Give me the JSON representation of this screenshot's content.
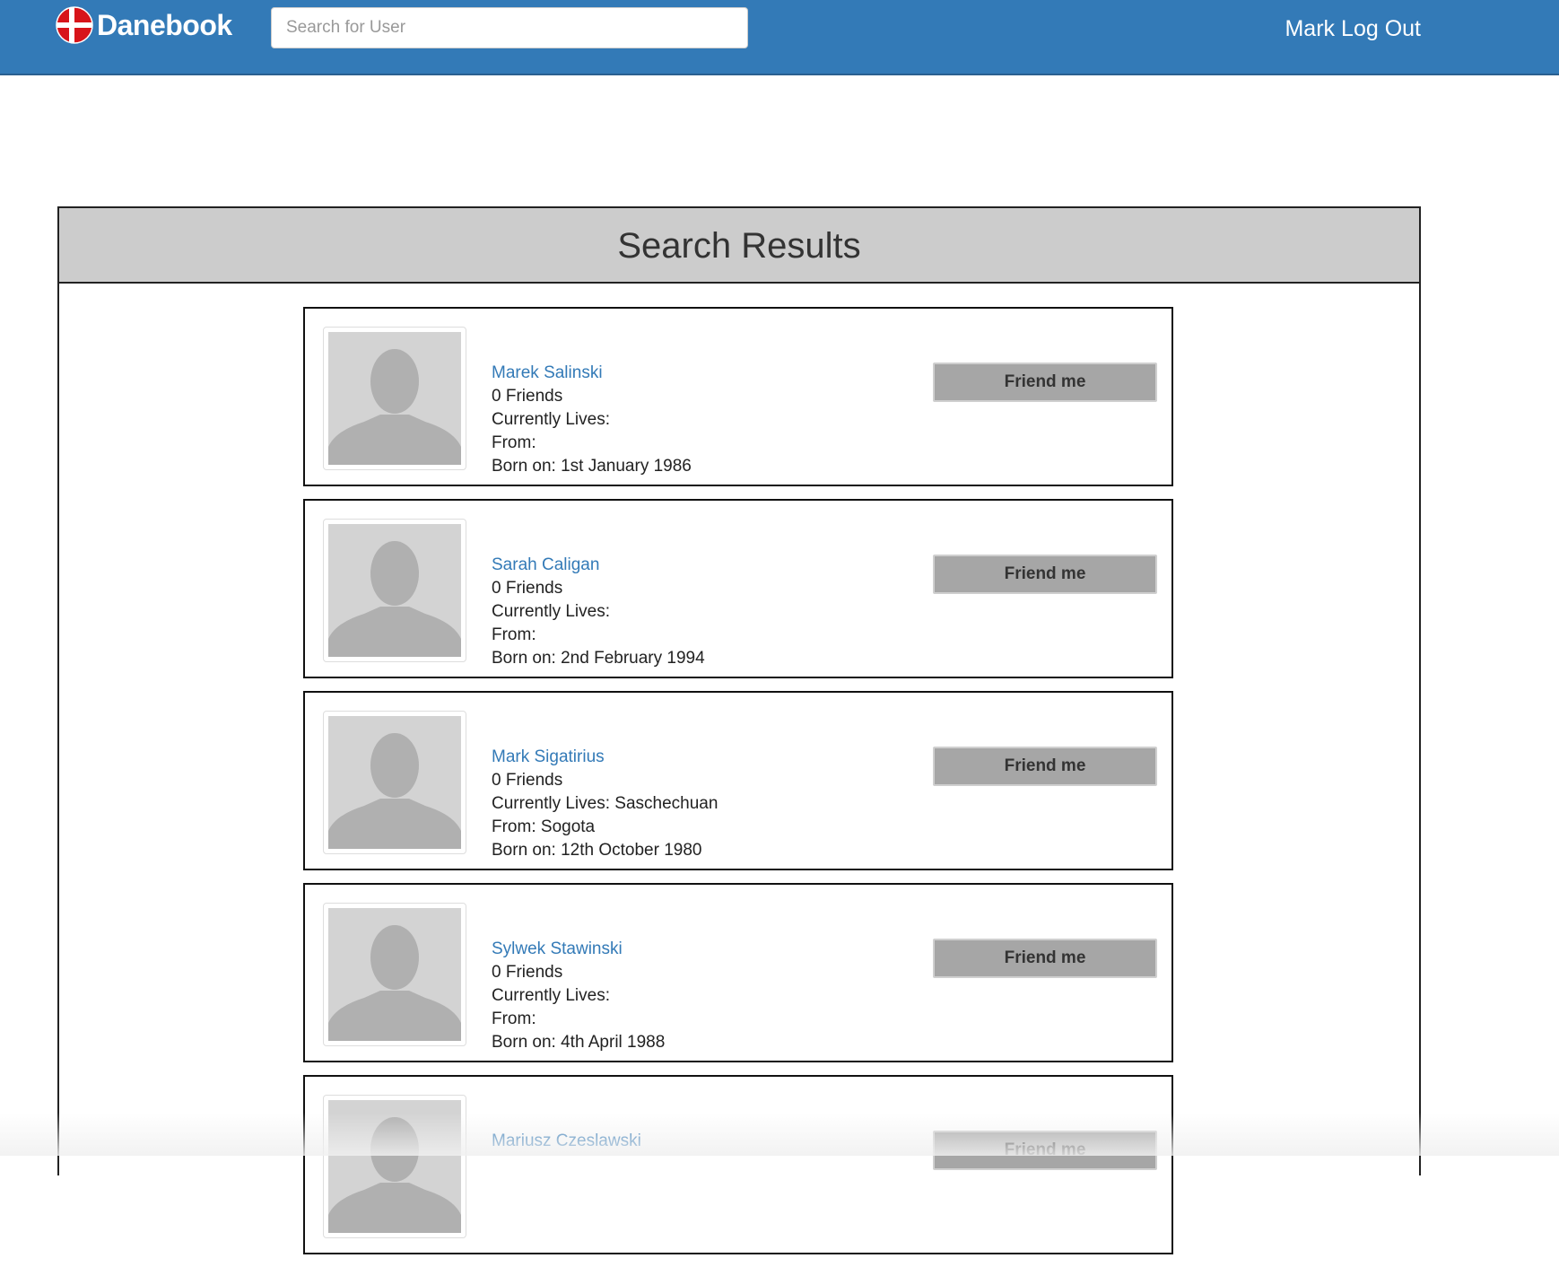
{
  "navbar": {
    "brand": "Danebook",
    "brand_icon": "danish-flag-icon",
    "search_placeholder": "Search for User",
    "search_value": "",
    "user_name": "Mark",
    "logout_label": "Log Out"
  },
  "results": {
    "title": "Search Results",
    "friend_button_label": "Friend me",
    "avatar_icon": "default-avatar-icon",
    "lives_label": "Currently Lives:",
    "from_label": "From:",
    "born_label": "Born on:",
    "users": [
      {
        "name": "Marek Salinski",
        "friends": "0 Friends",
        "lives": "",
        "from": "",
        "born": "1st January 1986"
      },
      {
        "name": "Sarah Caligan",
        "friends": "0 Friends",
        "lives": "",
        "from": "",
        "born": "2nd February 1994"
      },
      {
        "name": "Mark Sigatirius",
        "friends": "0 Friends",
        "lives": "Saschechuan",
        "from": "Sogota",
        "born": "12th October 1980"
      },
      {
        "name": "Sylwek Stawinski",
        "friends": "0 Friends",
        "lives": "",
        "from": "",
        "born": "4th April 1988"
      },
      {
        "name": "Mariusz Czeslawski",
        "friends": "",
        "lives": "",
        "from": "",
        "born": ""
      }
    ]
  },
  "colors": {
    "navbar": "#337ab7",
    "link": "#337ab7",
    "panel_heading": "#cccccc",
    "button": "#a6a6a6"
  }
}
